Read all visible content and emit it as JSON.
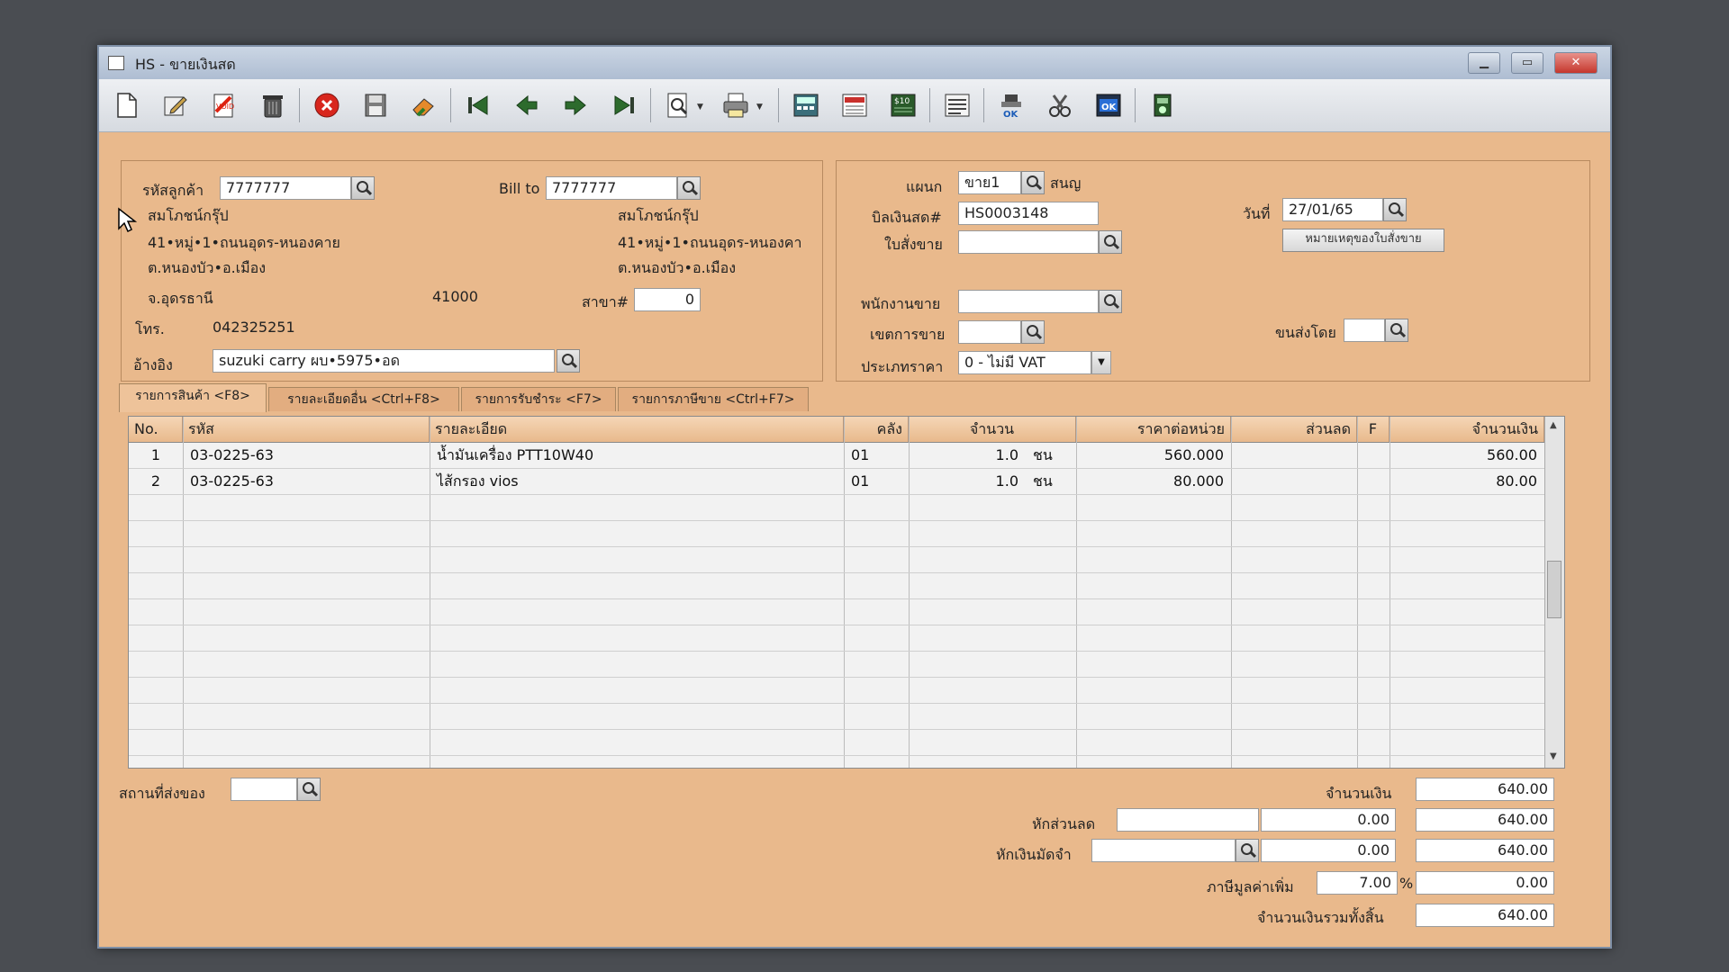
{
  "window": {
    "title": "HS - ขายเงินสด"
  },
  "toolbar": {
    "icons": [
      "new-document-icon",
      "edit-icon",
      "void-icon",
      "trash-icon",
      "cancel-icon",
      "save-icon",
      "eraser-icon",
      "first-record-icon",
      "previous-record-icon",
      "next-record-icon",
      "last-record-icon",
      "preview-icon",
      "print-icon",
      "calculator-icon",
      "printer-form-icon",
      "report-icon",
      "document-list-icon",
      "approve-icon",
      "tools-icon",
      "ok-icon",
      "exit-icon"
    ]
  },
  "customer": {
    "code_label": "รหัสลูกค้า",
    "code": "7777777",
    "name": "สมโภชน์กรุ๊ป",
    "address1": "41•หมู่•1•ถนนอุดร-หนองคาย",
    "address2": "ต.หนองบัว•อ.เมือง",
    "province": "จ.อุดรธานี",
    "postcode": "41000",
    "phone_label": "โทร.",
    "phone": "042325251",
    "reference_label": "อ้างอิง",
    "reference": "suzuki carry ผบ•5975•อด"
  },
  "bill_to": {
    "label": "Bill to",
    "code": "7777777",
    "name": "สมโภชน์กรุ๊ป",
    "address1": "41•หมู่•1•ถนนอุดร-หนองคา",
    "address2": "ต.หนองบัว•อ.เมือง",
    "branch_label": "สาขา#",
    "branch": "0"
  },
  "doc": {
    "dept_label": "แผนก",
    "dept": "ขาย1",
    "dept_name": "สนญ",
    "bill_label": "บิลเงินสด#",
    "bill_no": "HS0003148",
    "date_label": "วันที่",
    "date": "27/01/65",
    "order_label": "ใบสั่งขาย",
    "order": "",
    "remark_button": "หมายเหตุของใบสั่งขาย",
    "salesman_label": "พนักงานขาย",
    "salesman": "",
    "zone_label": "เขตการขาย",
    "zone": "",
    "ship_by_label": "ขนส่งโดย",
    "ship_by": "",
    "price_type_label": "ประเภทราคา",
    "price_type": "0 - ไม่มี VAT"
  },
  "tabs": [
    {
      "label": "รายการสินค้า <F8>"
    },
    {
      "label": "รายละเอียดอื่น <Ctrl+F8>"
    },
    {
      "label": "รายการรับชำระ <F7>"
    },
    {
      "label": "รายการภาษีขาย <Ctrl+F7>"
    }
  ],
  "grid": {
    "headers": [
      "No.",
      "รหัส",
      "รายละเอียด",
      "คลัง",
      "จำนวน",
      "ราคาต่อหน่วย",
      "ส่วนลด",
      "F",
      "จำนวนเงิน"
    ],
    "rows": [
      {
        "no": "1",
        "code": "03-0225-63",
        "desc": "น้ำมันเครื่อง PTT10W40",
        "wh": "01",
        "qty": "1.0",
        "unit": "ชน",
        "price": "560.000",
        "disc": "",
        "f": "",
        "amount": "560.00"
      },
      {
        "no": "2",
        "code": "03-0225-63",
        "desc": "ไส้กรอง vios",
        "wh": "01",
        "qty": "1.0",
        "unit": "ชน",
        "price": "80.000",
        "disc": "",
        "f": "",
        "amount": "80.00"
      }
    ]
  },
  "footer": {
    "ship_place_label": "สถานที่ส่งของ",
    "ship_place": "",
    "amount_label": "จำนวนเงิน",
    "amount": "640.00",
    "discount_label": "หักส่วนลด",
    "discount_text": "",
    "discount_value": "0.00",
    "after_discount": "640.00",
    "deposit_label": "หักเงินมัดจำ",
    "deposit_text": "",
    "deposit_value": "0.00",
    "after_deposit": "640.00",
    "vat_label": "ภาษีมูลค่าเพิ่ม",
    "vat_rate": "7.00",
    "vat_pct": "%",
    "vat_amount": "0.00",
    "total_label": "จำนวนเงินรวมทั้งสิ้น",
    "total": "640.00"
  }
}
